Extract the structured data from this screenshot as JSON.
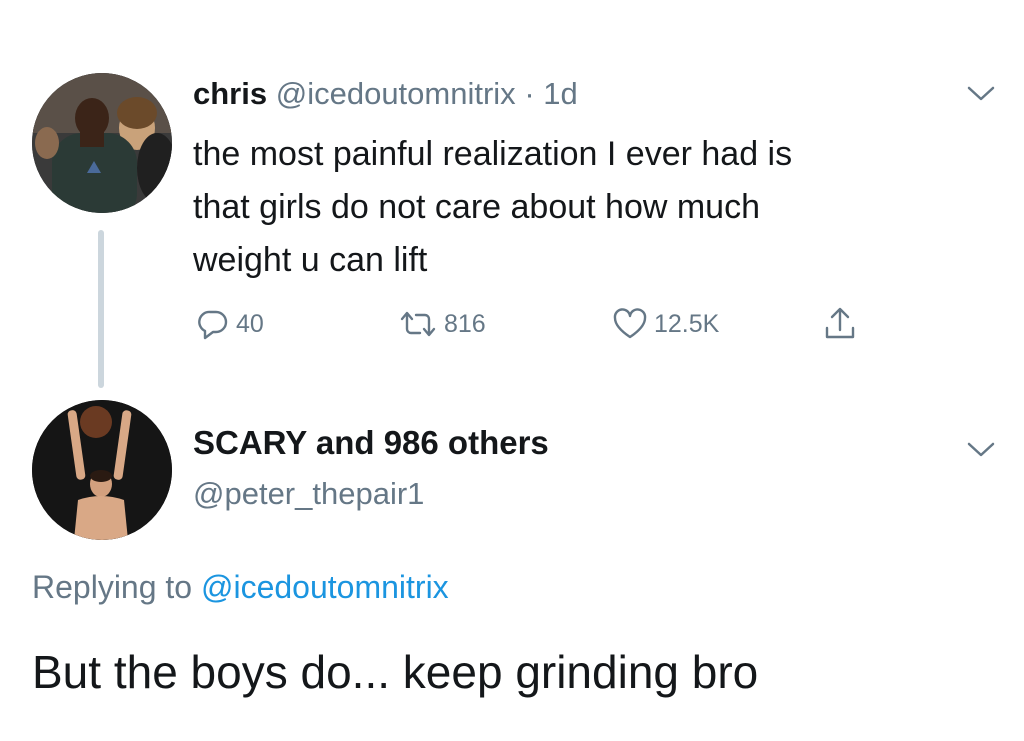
{
  "tweet": {
    "display_name": "chris",
    "handle": "@icedoutomnitrix",
    "separator": "·",
    "time": "1d",
    "text": "the most painful realization I ever had is\nthat girls do not care about how much\nweight u can lift",
    "actions": {
      "replies": "40",
      "retweets": "816",
      "likes": "12.5K"
    },
    "icons": {
      "reply": "reply-icon",
      "retweet": "retweet-icon",
      "like": "heart-icon",
      "share": "share-icon",
      "menu": "chevron-down-icon"
    }
  },
  "reply": {
    "display_name": "SCARY and 986 others",
    "handle": "@peter_thepair1",
    "replying_prefix": "Replying to ",
    "replying_to": "@icedoutomnitrix",
    "text": "But the boys do... keep grinding bro"
  },
  "colors": {
    "text_primary": "#14171a",
    "text_secondary": "#657786",
    "link": "#1b95e0",
    "thread_line": "#ccd6dd"
  }
}
